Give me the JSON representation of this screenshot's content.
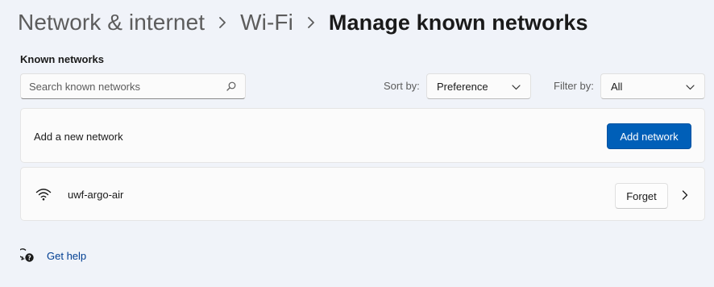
{
  "breadcrumb": {
    "items": [
      "Network & internet",
      "Wi-Fi"
    ],
    "current": "Manage known networks"
  },
  "known_networks": {
    "section_title": "Known networks",
    "search": {
      "placeholder": "Search known networks",
      "value": ""
    },
    "sort": {
      "label": "Sort by:",
      "value": "Preference"
    },
    "filter": {
      "label": "Filter by:",
      "value": "All"
    }
  },
  "add_network": {
    "text": "Add a new network",
    "button_label": "Add network"
  },
  "networks": [
    {
      "name": "uwf-argo-air",
      "icon": "wifi-icon",
      "forget_label": "Forget"
    }
  ],
  "help": {
    "label": "Get help"
  },
  "colors": {
    "accent": "#005fb8",
    "link": "#003e92",
    "background": "#f0f3f9"
  }
}
